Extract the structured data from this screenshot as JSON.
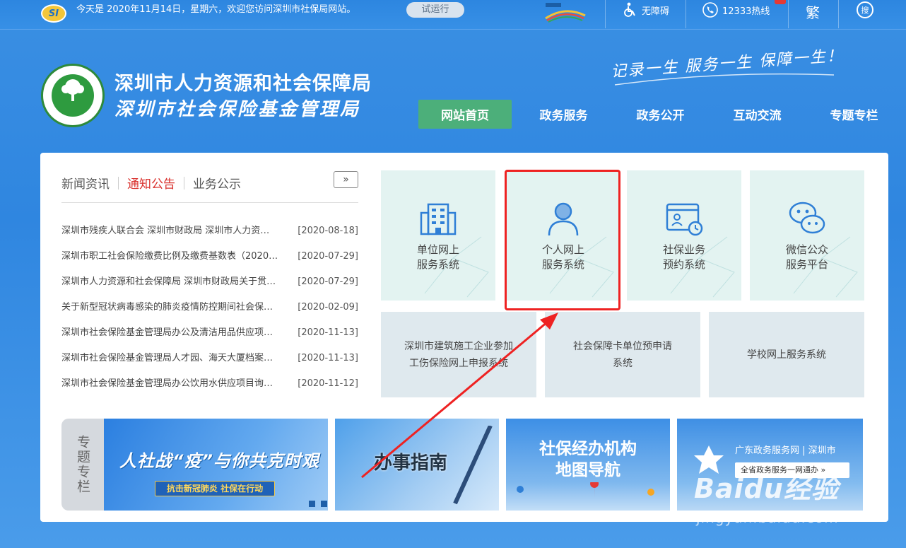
{
  "topbar": {
    "greeting": "今天是 2020年11月14日，星期六，欢迎您访问深圳市社保局网站。",
    "trial_badge": "试运行",
    "accessibility": "无障碍",
    "hotline": "12333热线",
    "traditional": "繁",
    "search": "搜",
    "logo_text": "SI"
  },
  "header": {
    "org_name_1": "深圳市人力资源和社会保障局",
    "org_name_2": "深圳市社会保险基金管理局",
    "slogan": "记录一生 服务一生 保障一生！"
  },
  "nav": {
    "items": [
      {
        "label": "网站首页"
      },
      {
        "label": "政务服务"
      },
      {
        "label": "政务公开"
      },
      {
        "label": "互动交流"
      },
      {
        "label": "专题专栏"
      }
    ]
  },
  "news": {
    "tabs": [
      "新闻资讯",
      "通知公告",
      "业务公示"
    ],
    "more": "»",
    "rows": [
      {
        "title": "深圳市残疾人联合会 深圳市财政局 深圳市人力资…",
        "date": "[2020-08-18]"
      },
      {
        "title": "深圳市职工社会保险缴费比例及缴费基数表（2020…",
        "date": "[2020-07-29]"
      },
      {
        "title": "深圳市人力资源和社会保障局 深圳市财政局关于贯…",
        "date": "[2020-07-29]"
      },
      {
        "title": "关于新型冠状病毒感染的肺炎疫情防控期间社会保…",
        "date": "[2020-02-09]"
      },
      {
        "title": "深圳市社会保险基金管理局办公及清洁用品供应项…",
        "date": "[2020-11-13]"
      },
      {
        "title": "深圳市社会保险基金管理局人才园、海天大厦档案…",
        "date": "[2020-11-13]"
      },
      {
        "title": "深圳市社会保险基金管理局办公饮用水供应项目询…",
        "date": "[2020-11-12]"
      }
    ]
  },
  "services": {
    "tiles": [
      {
        "line1": "单位网上",
        "line2": "服务系统",
        "icon": "building-icon"
      },
      {
        "line1": "个人网上",
        "line2": "服务系统",
        "icon": "person-icon"
      },
      {
        "line1": "社保业务",
        "line2": "预约系统",
        "icon": "calendar-clock-icon"
      },
      {
        "line1": "微信公众",
        "line2": "服务平台",
        "icon": "wechat-icon"
      }
    ],
    "wide": [
      {
        "line1": "深圳市建筑施工企业参加",
        "line2": "工伤保险网上申报系统"
      },
      {
        "line1": "社会保障卡单位预申请",
        "line2": "系统"
      },
      {
        "line1": "学校网上服务系统",
        "line2": ""
      }
    ]
  },
  "banners": {
    "special_label": "专题专栏",
    "b1_title": "人社战“疫”与你共克时艰",
    "b1_sub": "抗击新冠肺炎 社保在行动",
    "b2_title": "办事指南",
    "b3_line1": "社保经办机构",
    "b3_line2": "地图导航",
    "b4_title": "广东政务服务网 | 深圳市",
    "b4_pill": "全省政务服务一网通办 »"
  },
  "watermark": {
    "brand": "Baidu经验",
    "url": "jingyan.baidu.com"
  },
  "colors": {
    "highlight": "#ee2222",
    "nav_active": "#4caf7a",
    "tab_active": "#d9302c"
  }
}
